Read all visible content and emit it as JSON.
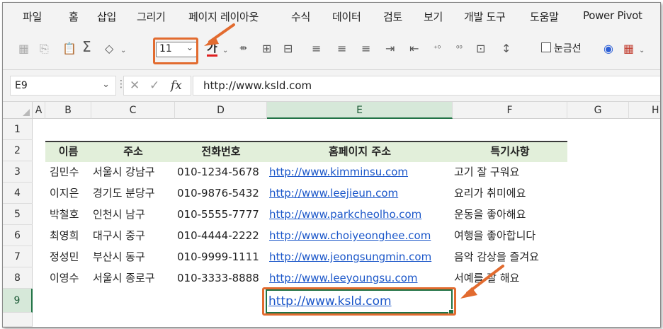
{
  "menu": [
    "파일",
    "홈",
    "삽입",
    "그리기",
    "페이지 레이아웃",
    "수식",
    "데이터",
    "검토",
    "보기",
    "개발 도구",
    "도움말",
    "Power Pivot"
  ],
  "ribbon": {
    "font_size": "11",
    "font_color_label": "가",
    "gridlines_label": "눈금선"
  },
  "formula_bar": {
    "cell_ref": "E9",
    "fx": "fx",
    "value": "http://www.ksld.com"
  },
  "columns": [
    "A",
    "B",
    "C",
    "D",
    "E",
    "F",
    "G",
    "H"
  ],
  "rows": [
    "1",
    "2",
    "3",
    "4",
    "5",
    "6",
    "7",
    "8",
    "9"
  ],
  "selected_cell": "E9",
  "table": {
    "headers": [
      "이름",
      "주소",
      "전화번호",
      "홈페이지 주소",
      "특기사항"
    ],
    "rows": [
      [
        "김민수",
        "서울시 강남구",
        "010-1234-5678",
        "http://www.kimminsu.com",
        "고기 잘 구워요"
      ],
      [
        "이지은",
        "경기도 분당구",
        "010-9876-5432",
        "http://www.leejieun.com",
        "요리가 취미에요"
      ],
      [
        "박철호",
        "인천시 남구",
        "010-5555-7777",
        "http://www.parkcheolho.com",
        "운동을 좋아해요"
      ],
      [
        "최영희",
        "대구시 중구",
        "010-4444-2222",
        "http://www.choiyeonghee.com",
        "여행을 좋아합니다"
      ],
      [
        "정성민",
        "부산시 동구",
        "010-9999-1111",
        "http://www.jeongsungmin.com",
        "음악 감상을 즐겨요"
      ],
      [
        "이영수",
        "서울시 종로구",
        "010-3333-8888",
        "http://www.leeyoungsu.com",
        "서예를 잘 해요"
      ]
    ],
    "row9_value": "http://www.ksld.com"
  },
  "colors": {
    "accent_highlight": "#e26b2f",
    "header_fill": "#e2efda",
    "link": "#1a56c9",
    "selection": "#217346"
  }
}
